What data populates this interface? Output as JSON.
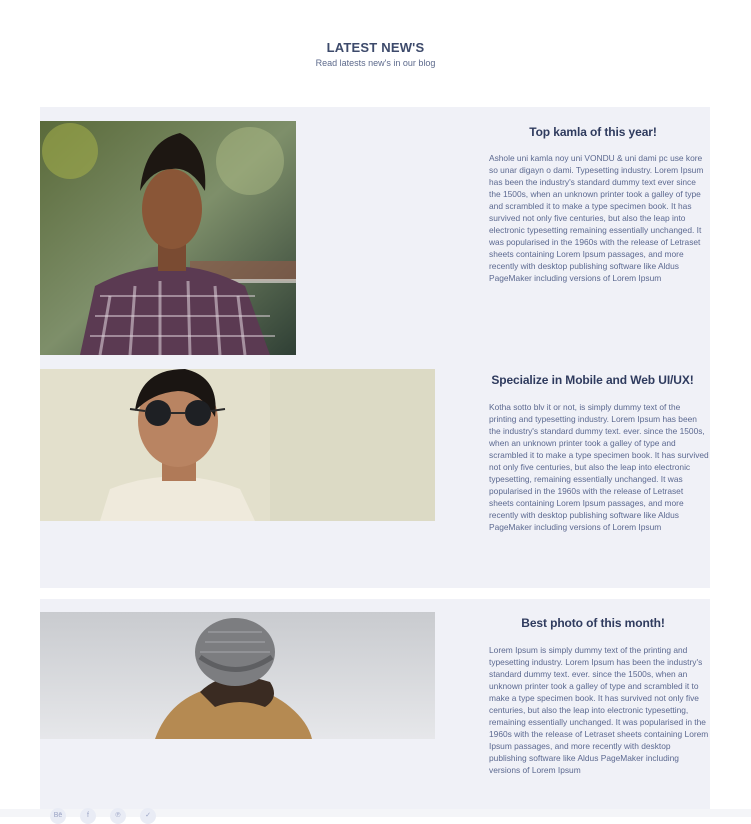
{
  "header": {
    "title": "LATEST NEW'S",
    "subtitle": "Read latests new's in our blog"
  },
  "articles": [
    {
      "title": "Top kamla of this year!",
      "body": "Ashole uni kamla noy uni VONDU & uni dami pc use kore so unar digayn o dami. Typesetting industry. Lorem Ipsum has been the industry's standard dummy text ever since the 1500s, when an unknown printer took a galley of type and scrambled it to make a type specimen book. It has survived not only five centuries, but also the leap into electronic typesetting remaining essentially unchanged. It was popularised in the 1960s with the release of Letraset sheets containing Lorem Ipsum passages, and more recently with desktop publishing software like Aldus PageMaker including versions of Lorem Ipsum"
    },
    {
      "title": "Specialize in Mobile and Web UI/UX!",
      "body": "Kotha sotto blv it or not, is simply dummy text of the printing and typesetting industry. Lorem Ipsum has been the industry's standard dummy text. ever. since the 1500s, when an unknown printer took a galley of type and scrambled it to make a type specimen book. It has survived not only five centuries, but also the leap into electronic typesetting, remaining essentially unchanged. It was popularised in the 1960s with the release of Letraset sheets containing Lorem Ipsum passages, and more recently with desktop publishing software like Aldus PageMaker including versions of Lorem Ipsum"
    },
    {
      "title": "Best photo of this month!",
      "body": "Lorem Ipsum is simply dummy text of the printing and typesetting industry. Lorem Ipsum has been the industry's standard dummy text. ever. since the 1500s, when an unknown printer took a galley of type and scrambled it to make a type specimen book. It has survived not only five centuries, but also the leap into electronic typesetting, remaining essentially unchanged. It was popularised in the 1960s with the release of Letraset sheets containing Lorem Ipsum passages, and more recently with desktop publishing software like Aldus PageMaker including versions of Lorem Ipsum"
    }
  ],
  "social_icons": [
    "behance-icon",
    "facebook-icon",
    "pinterest-icon",
    "twitter-icon"
  ],
  "colors": {
    "card_bg": "#f0f1f7",
    "title": "#2f3b5e",
    "body_text": "#5c6990"
  }
}
